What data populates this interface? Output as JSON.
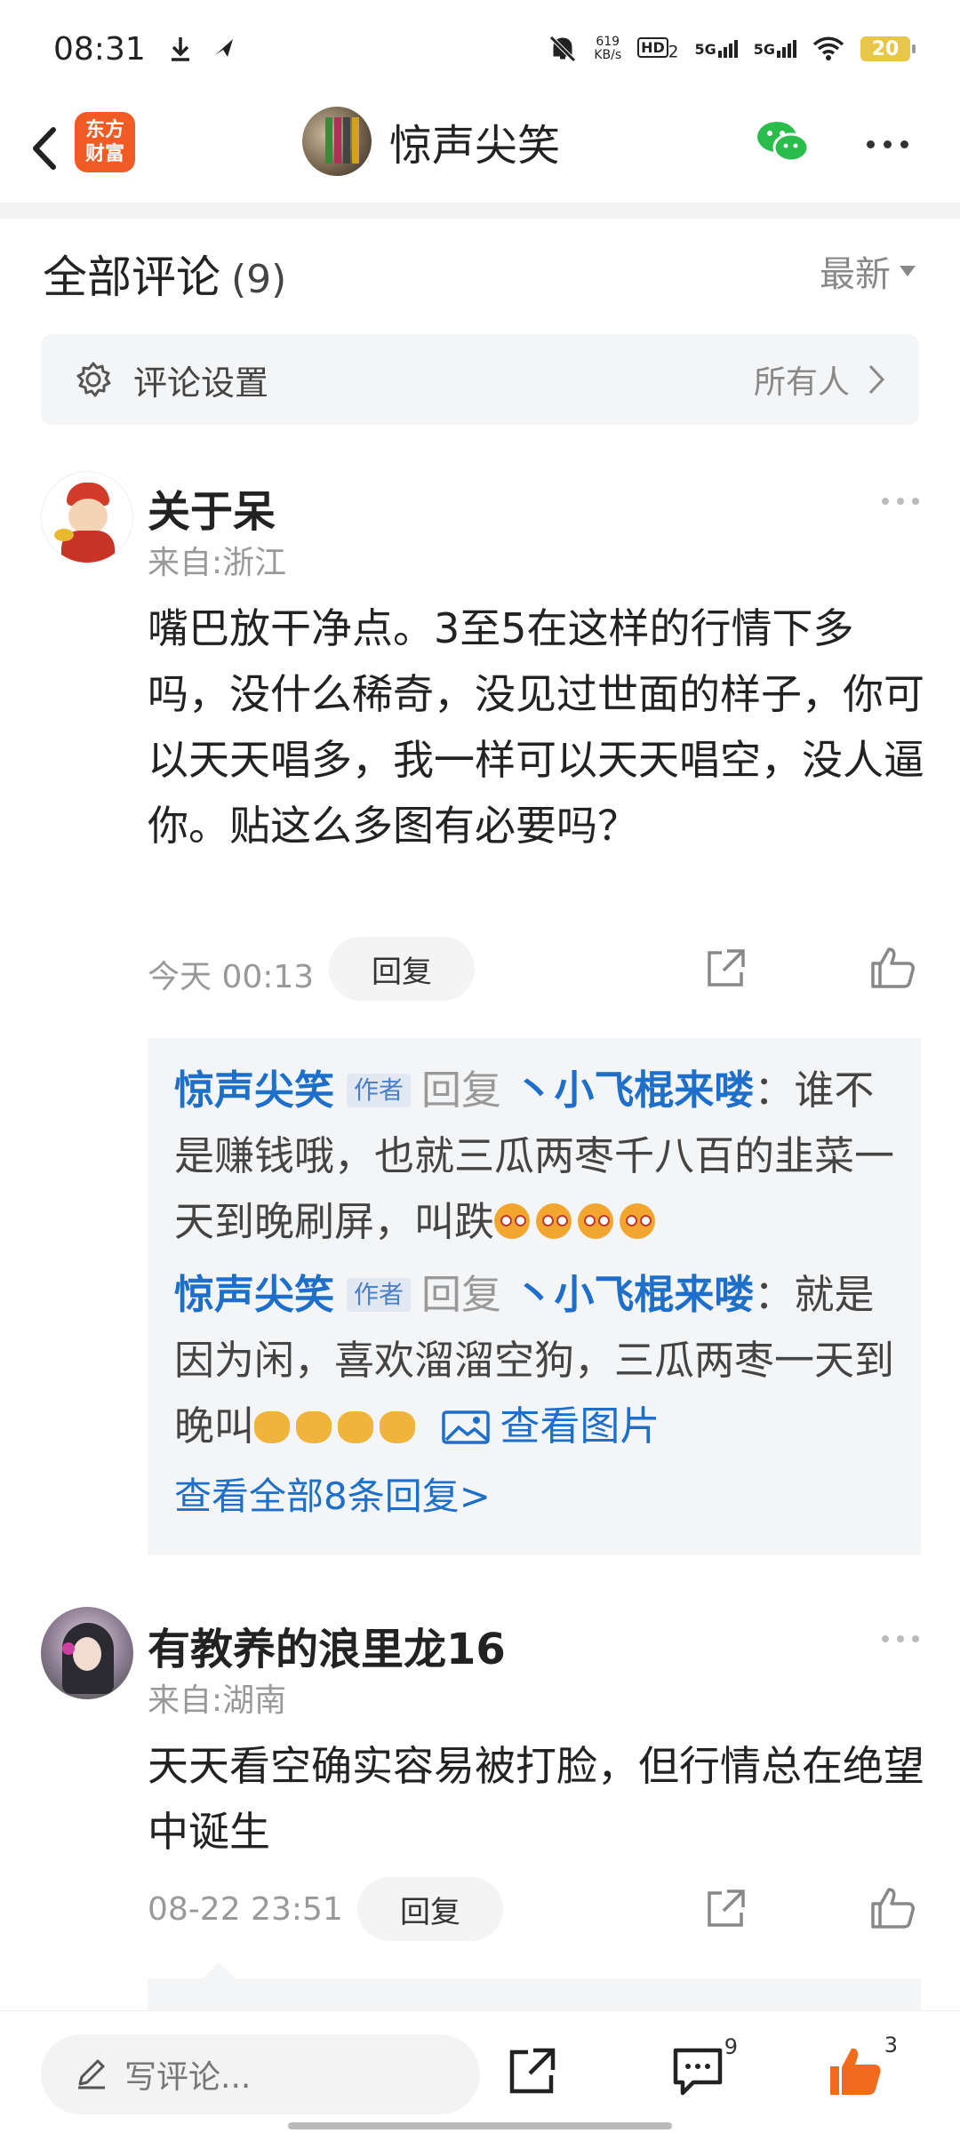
{
  "status_bar": {
    "time": "08:31",
    "speed_top": "619",
    "speed_bottom": "KB/s",
    "hd_label": "HD",
    "hd_sub": "2",
    "net1": "5G",
    "net2": "5G",
    "battery": "20"
  },
  "header": {
    "logo_line1": "东方",
    "logo_line2": "财富",
    "title": "惊声尖笑"
  },
  "comments_section": {
    "title": "全部评论",
    "count": "(9)",
    "sort_label": "最新"
  },
  "settings_row": {
    "label": "评论设置",
    "value": "所有人"
  },
  "comments": [
    {
      "username": "关于呆",
      "location": "来自:浙江",
      "text": "嘴巴放干净点。3至5在这样的行情下多吗，没什么稀奇，没见过世面的样子，你可以天天唱多，我一样可以天天唱空，没人逼你。贴这么多图有必要吗？",
      "time": "今天 00:13",
      "reply_label": "回复",
      "replies": [
        {
          "author": "惊声尖笑",
          "tag": "作者",
          "reply_word": "回复",
          "target": "丶小飞棍来喽",
          "text": "：谁不是赚钱哦，也就三瓜两枣千八百的韭菜一天到晚刷屏，叫跌"
        },
        {
          "author": "惊声尖笑",
          "tag": "作者",
          "reply_word": "回复",
          "target": "丶小飞棍来喽",
          "text": "：就是因为闲，喜欢溜溜空狗，三瓜两枣一天到晚叫",
          "view_image": "查看图片"
        }
      ],
      "view_all": "查看全部8条回复>"
    },
    {
      "username": "有教养的浪里龙16",
      "location": "来自:湖南",
      "text": "天天看空确实容易被打脸，但行情总在绝望中诞生",
      "time": "08-22 23:51",
      "reply_label": "回复"
    }
  ],
  "bottom_bar": {
    "write_placeholder": "写评论...",
    "comment_count": "9",
    "like_count": "3"
  },
  "colors": {
    "link_blue": "#1e6fc9",
    "brand_orange": "#f05a23",
    "like_orange": "#f26a1b",
    "wechat_green": "#2bbd4b"
  }
}
